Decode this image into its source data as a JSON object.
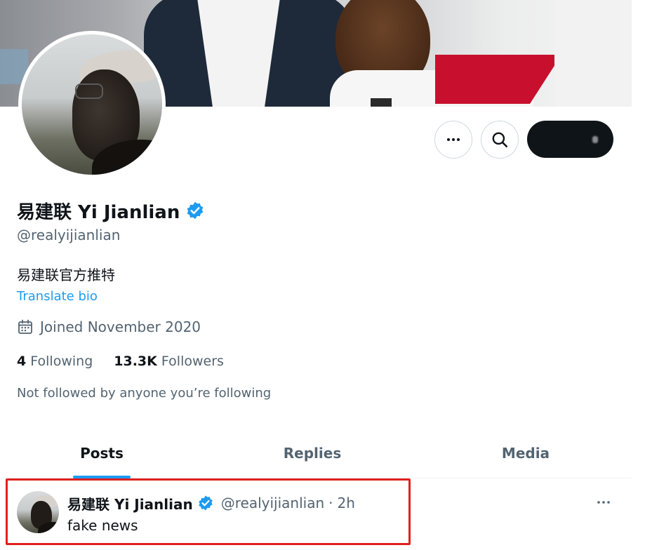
{
  "profile": {
    "display_name": "易建联 Yi Jianlian",
    "handle": "@realyijianlian",
    "bio": "易建联官方推特",
    "translate_label": "Translate bio",
    "joined": "Joined November 2020",
    "following_count": "4",
    "following_label": "Following",
    "followers_count": "13.3K",
    "followers_label": "Followers",
    "not_followed_text": "Not followed by anyone you’re following",
    "verified": true
  },
  "tabs": [
    {
      "label": "Posts",
      "active": true
    },
    {
      "label": "Replies",
      "active": false
    },
    {
      "label": "Media",
      "active": false
    }
  ],
  "post": {
    "author_name": "易建联 Yi Jianlian",
    "author_handle": "@realyijianlian",
    "separator": "·",
    "time": "2h",
    "text": "fake news"
  },
  "icons": {
    "more": "more-horizontal-icon",
    "search": "search-icon",
    "verified": "verified-badge-icon",
    "calendar": "calendar-icon"
  },
  "colors": {
    "accent": "#1d9bf0",
    "text_primary": "#0f1419",
    "text_secondary": "#536471",
    "highlight": "#e02020",
    "follow_button": "#0f1419"
  }
}
